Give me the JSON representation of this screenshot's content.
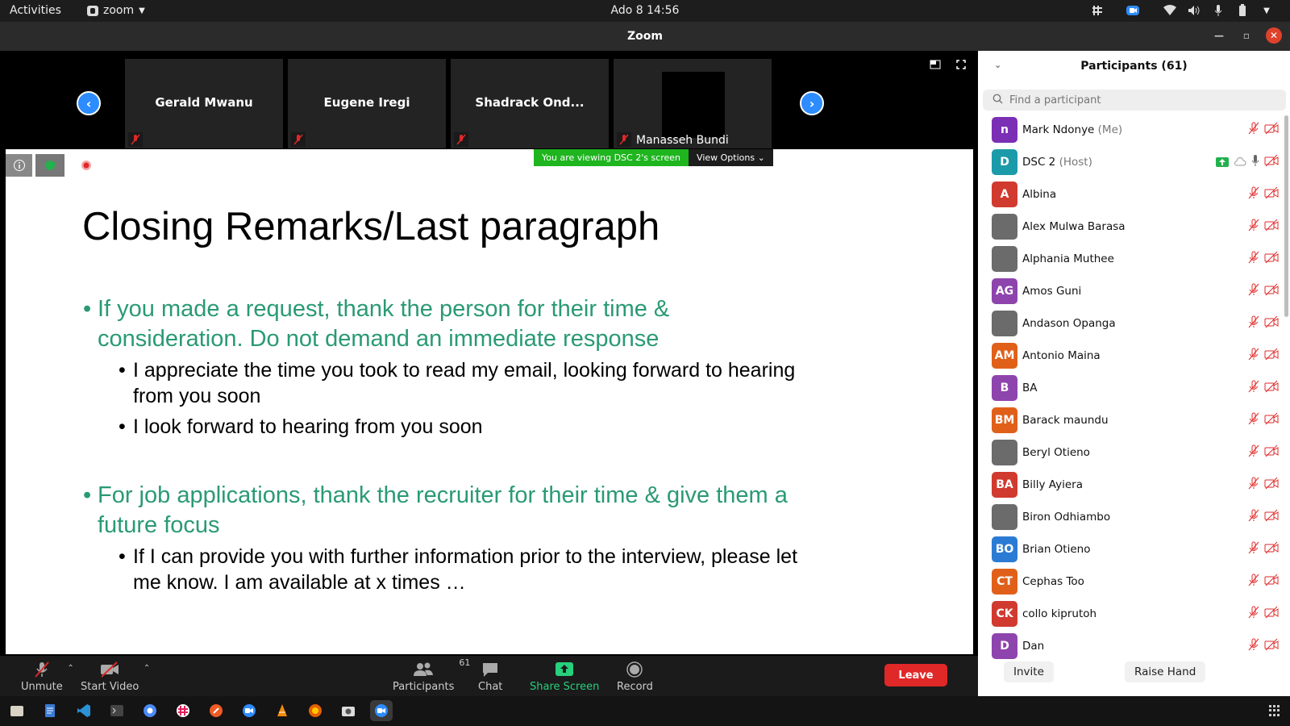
{
  "topbar": {
    "activities": "Activities",
    "app_name": "zoom",
    "clock": "Ado 8  14:56"
  },
  "window": {
    "title": "Zoom"
  },
  "video_strip": {
    "tiles": [
      {
        "name": "Gerald Mwanu"
      },
      {
        "name": "Eugene Iregi"
      },
      {
        "name": "Shadrack Ond..."
      },
      {
        "name": "Manasseh Bundi"
      }
    ]
  },
  "share": {
    "viewing_message": "You are viewing DSC 2's screen",
    "view_options": "View Options"
  },
  "slide": {
    "title": "Closing Remarks/Last paragraph",
    "bullets": [
      {
        "line1": "If you made a request, thank the person for their time &",
        "line2": "consideration. Do not demand an immediate response"
      },
      {
        "line1": "I appreciate the time you took to read my email, looking forward to hearing",
        "line2": "from you soon"
      },
      {
        "line1": "I look forward to hearing from you soon"
      },
      {
        "line1": "For job applications, thank the recruiter for their time & give them a",
        "line2": "future focus"
      },
      {
        "line1": "If I can provide you with further information prior to the interview, please let",
        "line2": "me know. I am available at x times …"
      }
    ],
    "colors": {
      "level1": "#2a9a74",
      "level2": "#000000"
    }
  },
  "toolbar": {
    "unmute": "Unmute",
    "start_video": "Start Video",
    "participants": "Participants",
    "participants_count": "61",
    "chat": "Chat",
    "share_screen": "Share Screen",
    "record": "Record",
    "leave": "Leave"
  },
  "panel": {
    "title": "Participants (61)",
    "search_placeholder": "Find a participant",
    "invite": "Invite",
    "raise_hand": "Raise Hand",
    "participants": [
      {
        "name": "Mark Ndonye",
        "role": "(Me)",
        "initials": "n",
        "color": "#7b2fb5"
      },
      {
        "name": "DSC 2",
        "role": "(Host)",
        "initials": "D",
        "color": "#1b9aaa"
      },
      {
        "name": "Albina",
        "role": "",
        "initials": "A",
        "color": "#d13a2f"
      },
      {
        "name": "Alex Mulwa Barasa",
        "role": "",
        "initials": "",
        "color": "photo"
      },
      {
        "name": "Alphania Muthee",
        "role": "",
        "initials": "",
        "color": "photo"
      },
      {
        "name": "Amos Guni",
        "role": "",
        "initials": "AG",
        "color": "#8e44ad"
      },
      {
        "name": "Andason Opanga",
        "role": "",
        "initials": "",
        "color": "photo"
      },
      {
        "name": "Antonio Maina",
        "role": "",
        "initials": "AM",
        "color": "#e0601a"
      },
      {
        "name": "BA",
        "role": "",
        "initials": "B",
        "color": "#8e44ad"
      },
      {
        "name": "Barack maundu",
        "role": "",
        "initials": "BM",
        "color": "#e0601a"
      },
      {
        "name": "Beryl Otieno",
        "role": "",
        "initials": "",
        "color": "photo"
      },
      {
        "name": "Billy Ayiera",
        "role": "",
        "initials": "BA",
        "color": "#d13a2f"
      },
      {
        "name": "Biron Odhiambo",
        "role": "",
        "initials": "",
        "color": "photo"
      },
      {
        "name": "Brian Otieno",
        "role": "",
        "initials": "BO",
        "color": "#2b7bd4"
      },
      {
        "name": "Cephas Too",
        "role": "",
        "initials": "CT",
        "color": "#e0601a"
      },
      {
        "name": "collo kiprutoh",
        "role": "",
        "initials": "CK",
        "color": "#d13a2f"
      },
      {
        "name": "Dan",
        "role": "",
        "initials": "D",
        "color": "#8e44ad"
      }
    ]
  },
  "colors": {
    "accent": "#2d8cff",
    "share_green": "#26d07c",
    "leave_red": "#e02828"
  }
}
